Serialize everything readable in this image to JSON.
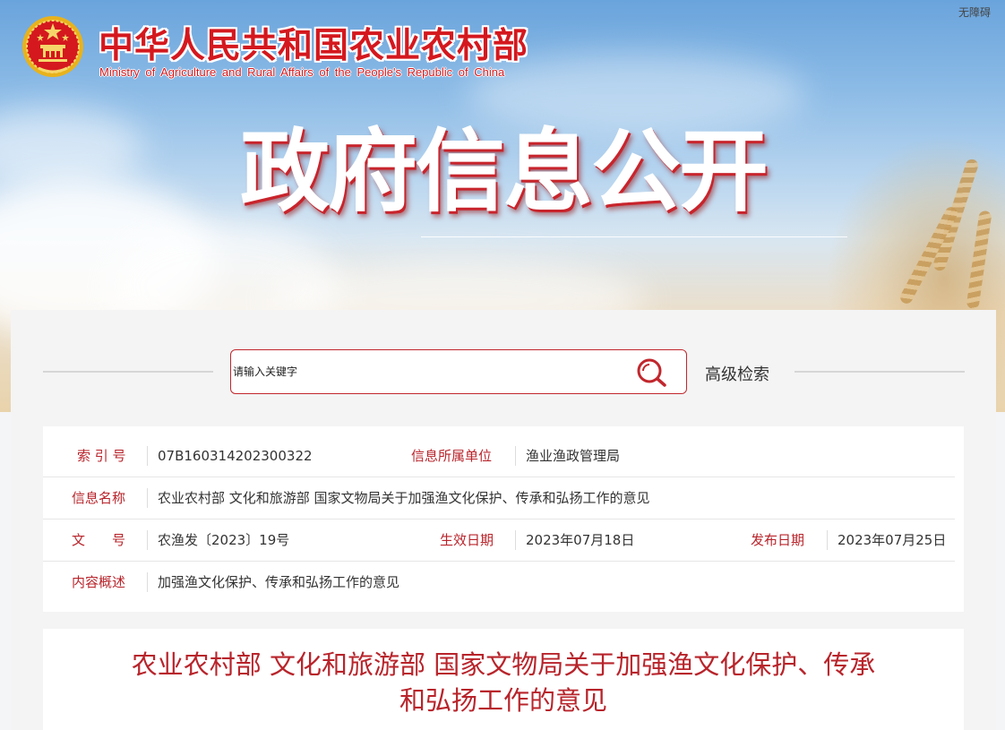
{
  "header": {
    "site_name_cn": "中华人民共和国农业农村部",
    "site_name_en": "Ministry of Agriculture and Rural Affairs of the People's Republic of China",
    "accessibility_link": "无障碍",
    "hero_title": "政府信息公开",
    "brand_color": "#d4181e"
  },
  "search": {
    "placeholder": "请输入关键字",
    "value": "",
    "advanced_label": "高级检索"
  },
  "info": {
    "index_label": "索 引 号",
    "index_value": "07B160314202300322",
    "unit_label": "信息所属单位",
    "unit_value": "渔业渔政管理局",
    "name_label": "信息名称",
    "name_value": "农业农村部 文化和旅游部 国家文物局关于加强渔文化保护、传承和弘扬工作的意见",
    "doc_no_label": "文　　号",
    "doc_no_value": "农渔发〔2023〕19号",
    "effective_label": "生效日期",
    "effective_value": "2023年07月18日",
    "publish_label": "发布日期",
    "publish_value": "2023年07月25日",
    "summary_label": "内容概述",
    "summary_value": "加强渔文化保护、传承和弘扬工作的意见",
    "label_color": "#b8242b"
  },
  "article": {
    "title_line1": "农业农村部 文化和旅游部 国家文物局关于加强渔文化保护、传承",
    "title_line2": "和弘扬工作的意见"
  }
}
